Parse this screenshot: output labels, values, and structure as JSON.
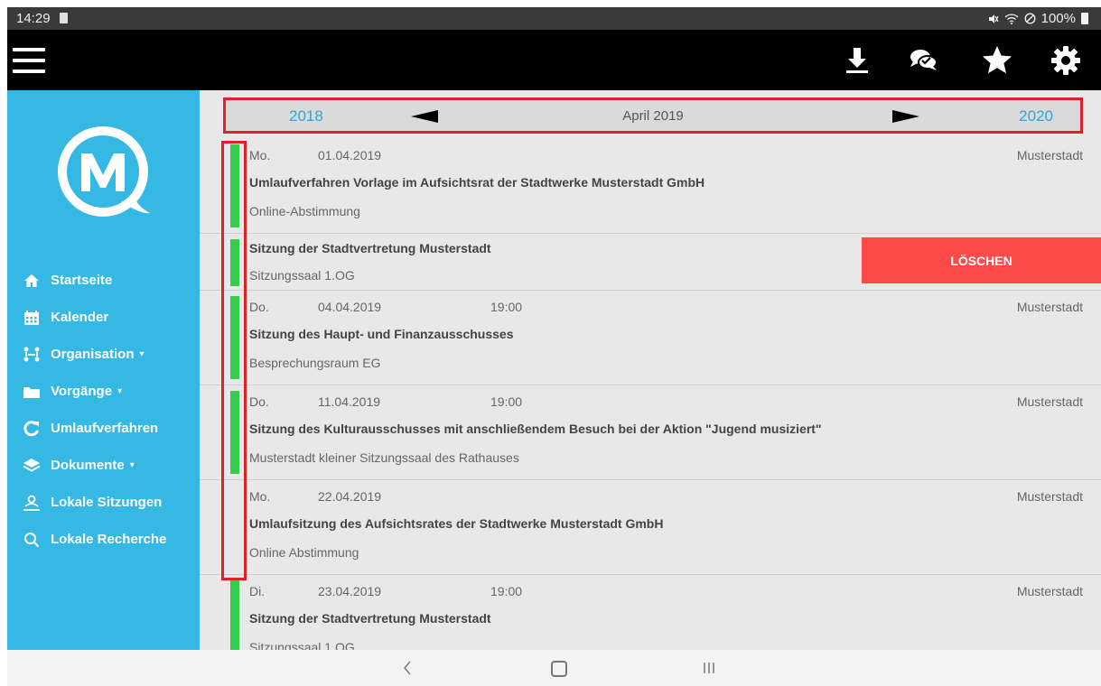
{
  "statusbar": {
    "time": "14:29",
    "battery": "100%"
  },
  "appbar": {
    "icons": [
      "menu-icon",
      "download-icon",
      "chat-icon",
      "star-icon",
      "gear-icon"
    ]
  },
  "sidebar": {
    "items": [
      {
        "label": "Startseite",
        "icon": "home-icon"
      },
      {
        "label": "Kalender",
        "icon": "calendar-icon"
      },
      {
        "label": "Organisation",
        "icon": "org-icon",
        "caret": "▾"
      },
      {
        "label": "Vorgänge",
        "icon": "folder-icon",
        "caret": "▾"
      },
      {
        "label": "Umlaufverfahren",
        "icon": "refresh-icon"
      },
      {
        "label": "Dokumente",
        "icon": "layers-icon",
        "caret": "▾"
      },
      {
        "label": "Lokale Sitzungen",
        "icon": "map-person-icon"
      },
      {
        "label": "Lokale Recherche",
        "icon": "search-icon"
      }
    ]
  },
  "calendar": {
    "prev_year": "2018",
    "month": "April 2019",
    "next_year": "2020"
  },
  "events": [
    {
      "dow": "Mo.",
      "date": "01.04.2019",
      "time": "",
      "place": "Musterstadt",
      "title": "Umlaufverfahren Vorlage im Aufsichtsrat der Stadtwerke Musterstadt GmbH",
      "room": "Online-Abstimmung",
      "flag": true
    },
    {
      "title": "Sitzung der Stadtvertretung Musterstadt",
      "room": "Sitzungssaal 1.OG",
      "flag": true,
      "delete_label": "LÖSCHEN"
    },
    {
      "dow": "Do.",
      "date": "04.04.2019",
      "time": "19:00",
      "place": "Musterstadt",
      "title": "Sitzung des Haupt- und Finanzausschusses",
      "room": "Besprechungsraum EG",
      "flag": true
    },
    {
      "dow": "Do.",
      "date": "11.04.2019",
      "time": "19:00",
      "place": "Musterstadt",
      "title": "Sitzung des Kulturausschusses mit anschließendem Besuch bei der Aktion \"Jugend musiziert\"",
      "room": "Musterstadt kleiner Sitzungssaal des Rathauses",
      "flag": true
    },
    {
      "dow": "Mo.",
      "date": "22.04.2019",
      "time": "",
      "place": "Musterstadt",
      "title": "Umlaufsitzung des Aufsichtsrates der Stadtwerke Musterstadt GmbH",
      "room": "Online Abstimmung",
      "flag": false
    },
    {
      "dow": "Di.",
      "date": "23.04.2019",
      "time": "19:00",
      "place": "Musterstadt",
      "title": "Sitzung der Stadtvertretung Musterstadt",
      "room": "Sitzungssaal 1.OG",
      "flag": true
    }
  ],
  "colors": {
    "sidebar": "#35b8e4",
    "flag": "#32cd4b",
    "delete": "#ff4a4a",
    "highlight": "#e0202a",
    "year_link": "#2aa7dd"
  }
}
